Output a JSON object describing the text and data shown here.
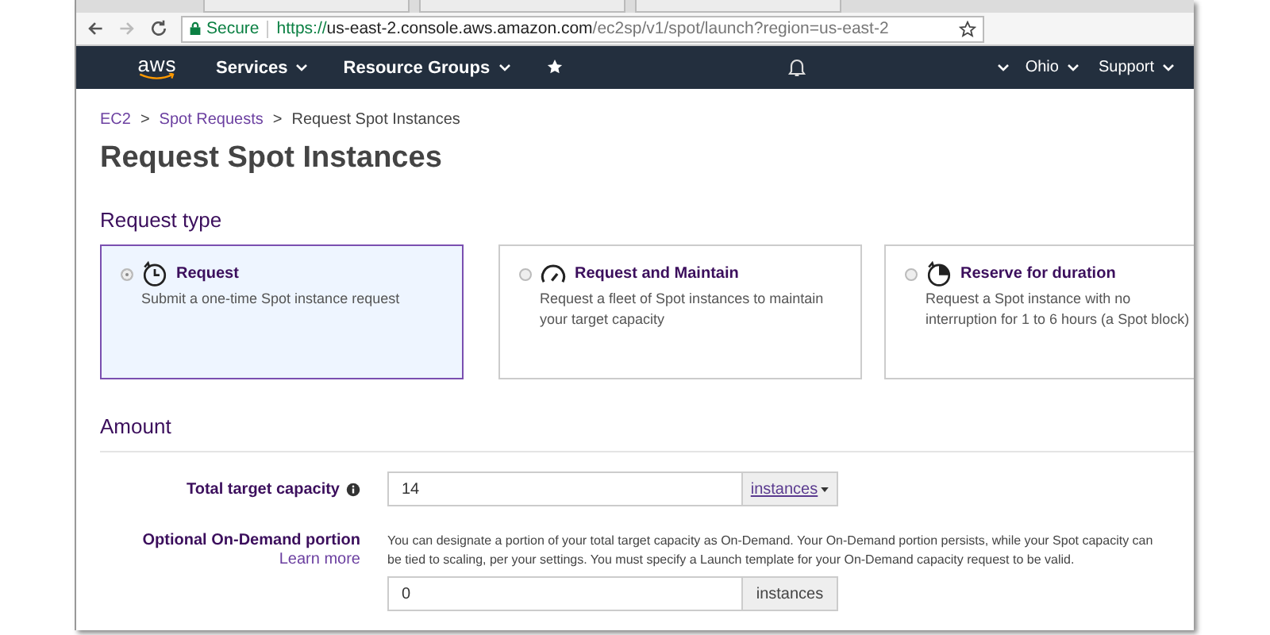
{
  "browser": {
    "secure_label": "Secure",
    "url_scheme": "https://",
    "url_host": "us-east-2.console.aws.amazon.com",
    "url_path": "/ec2sp/v1/spot/launch?region=us-east-2"
  },
  "navbar": {
    "logo": "aws",
    "menus": [
      {
        "label": "Services"
      },
      {
        "label": "Resource Groups"
      }
    ],
    "region": "Ohio",
    "support": "Support"
  },
  "breadcrumb": {
    "separator": ">",
    "items": [
      {
        "label": "EC2",
        "link": true
      },
      {
        "label": "Spot Requests",
        "link": true
      },
      {
        "label": "Request Spot Instances",
        "link": false
      }
    ]
  },
  "title": "Request Spot Instances",
  "request_type": {
    "heading": "Request type",
    "options": [
      {
        "kind": "clock",
        "title": "Request",
        "description": "Submit a one-time Spot instance request",
        "selected": true
      },
      {
        "kind": "gauge",
        "title": "Request and Maintain",
        "description": "Request a fleet of Spot instances to maintain your target capacity",
        "selected": false
      },
      {
        "kind": "timer",
        "title": "Reserve for duration",
        "description": "Request a Spot instance with no interruption for 1 to 6 hours (a Spot block)",
        "selected": false
      }
    ]
  },
  "amount": {
    "heading": "Amount",
    "fields": [
      {
        "label": "Total target capacity",
        "info": true,
        "value": "14",
        "unit": "instances",
        "unit_dropdown": true
      },
      {
        "label": "Optional On-Demand portion",
        "info": false,
        "link": "Learn more",
        "help": "You can designate a portion of your total target capacity as On-Demand. Your On-Demand portion persists, while your Spot capacity can be tied to scaling, per your settings. You must specify a Launch template for your On-Demand capacity request to be valid.",
        "value": "0",
        "unit": "instances",
        "unit_dropdown": false
      }
    ]
  }
}
